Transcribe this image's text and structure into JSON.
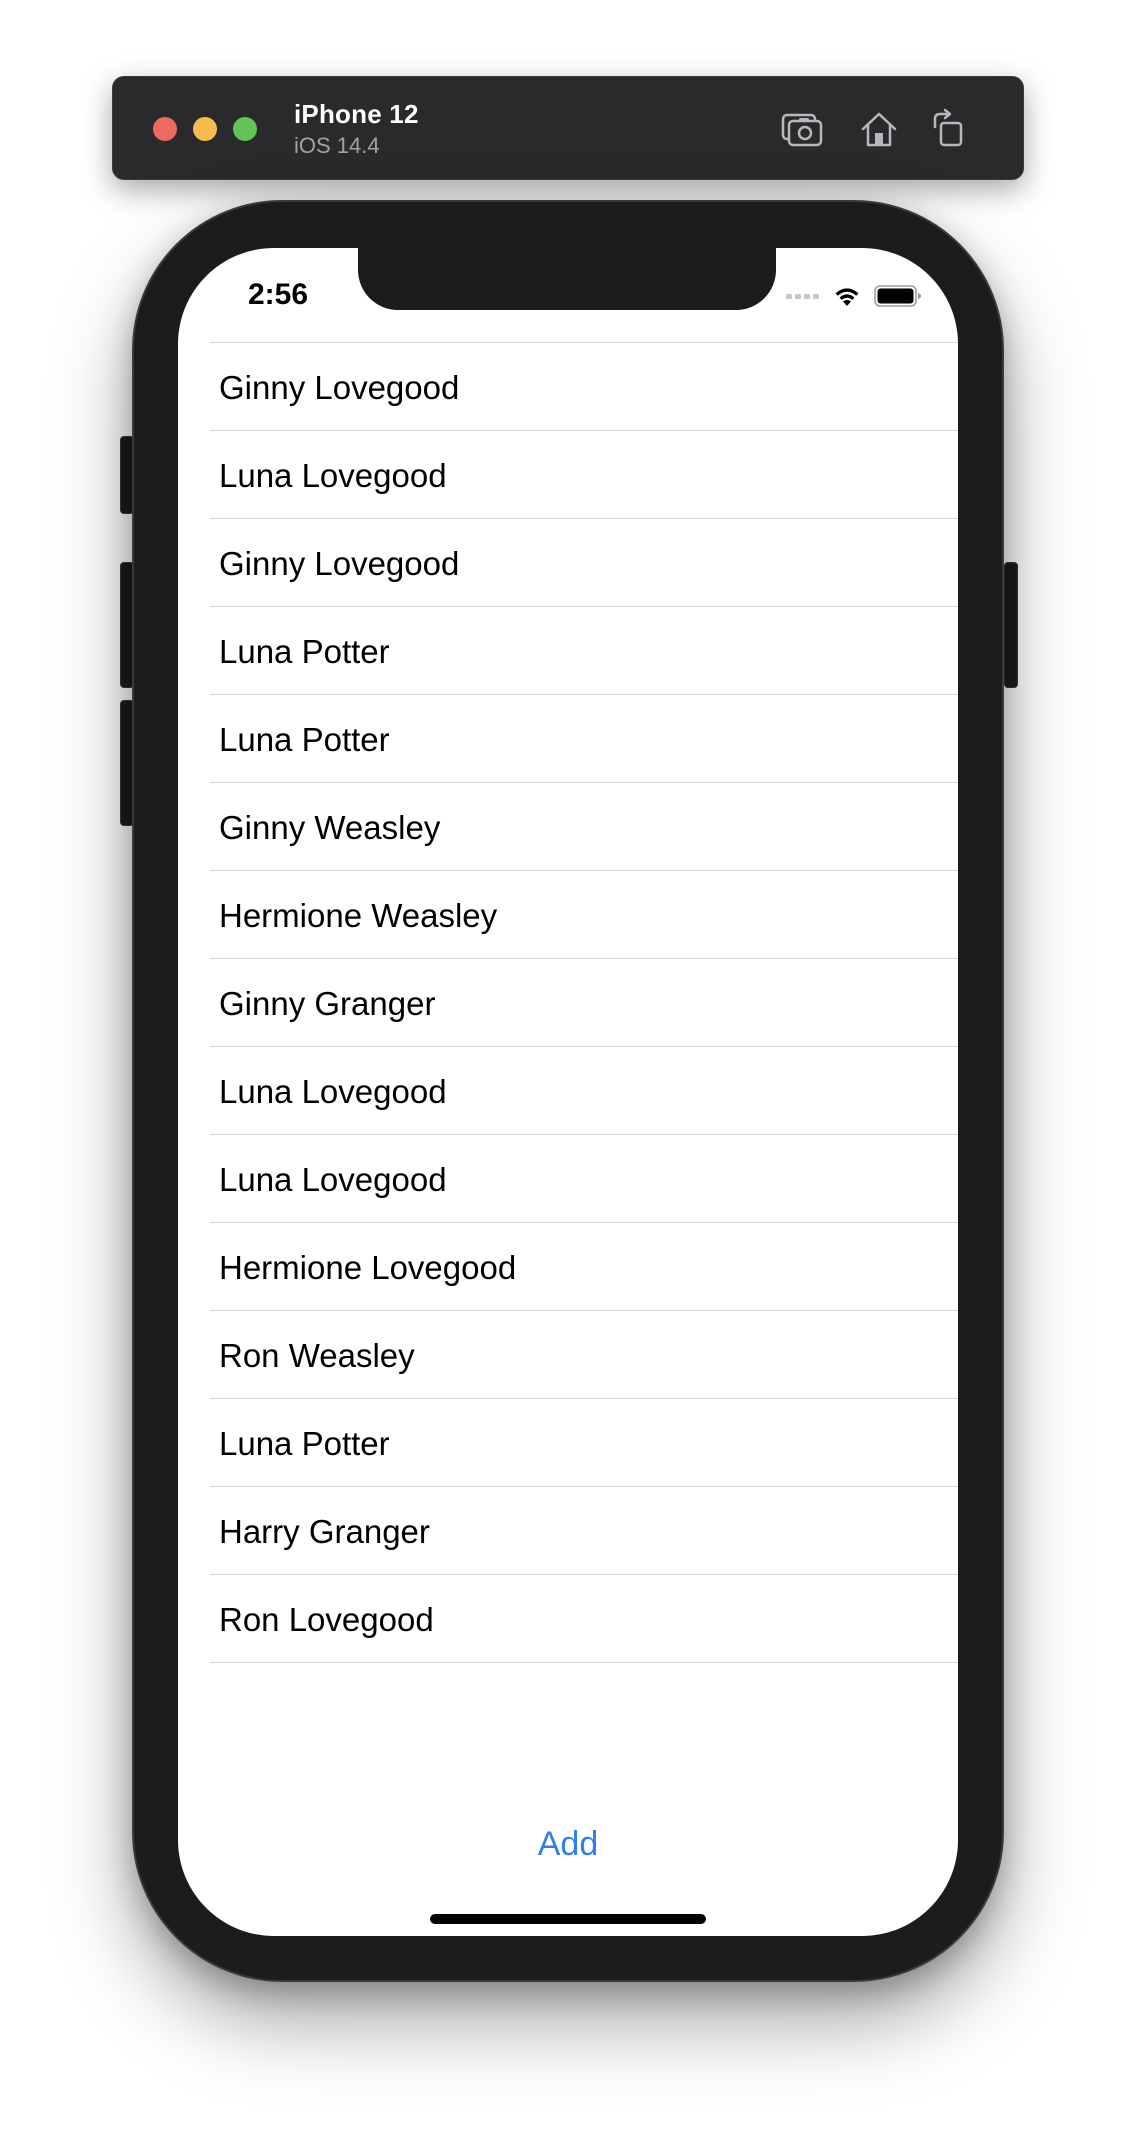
{
  "simulator": {
    "device_name": "iPhone 12",
    "os_version": "iOS 14.4",
    "toolbar": [
      {
        "icon": "screenshot-icon"
      },
      {
        "icon": "home-icon"
      },
      {
        "icon": "rotate-icon"
      }
    ]
  },
  "status_bar": {
    "time": "2:56"
  },
  "list": {
    "items": [
      {
        "label": "Ginny Lovegood"
      },
      {
        "label": "Luna Lovegood"
      },
      {
        "label": "Ginny Lovegood"
      },
      {
        "label": "Luna Potter"
      },
      {
        "label": "Luna Potter"
      },
      {
        "label": "Ginny Weasley"
      },
      {
        "label": "Hermione Weasley"
      },
      {
        "label": "Ginny Granger"
      },
      {
        "label": "Luna Lovegood"
      },
      {
        "label": "Luna Lovegood"
      },
      {
        "label": "Hermione Lovegood"
      },
      {
        "label": "Ron Weasley"
      },
      {
        "label": "Luna Potter"
      },
      {
        "label": "Harry Granger"
      },
      {
        "label": "Ron Lovegood"
      }
    ]
  },
  "footer": {
    "add_label": "Add"
  },
  "colors": {
    "accent": "#2f80ed",
    "traffic_red": "#ee6a5e",
    "traffic_yellow": "#f5bd4f",
    "traffic_green": "#61c454",
    "device_frame": "#1c1c1e"
  }
}
